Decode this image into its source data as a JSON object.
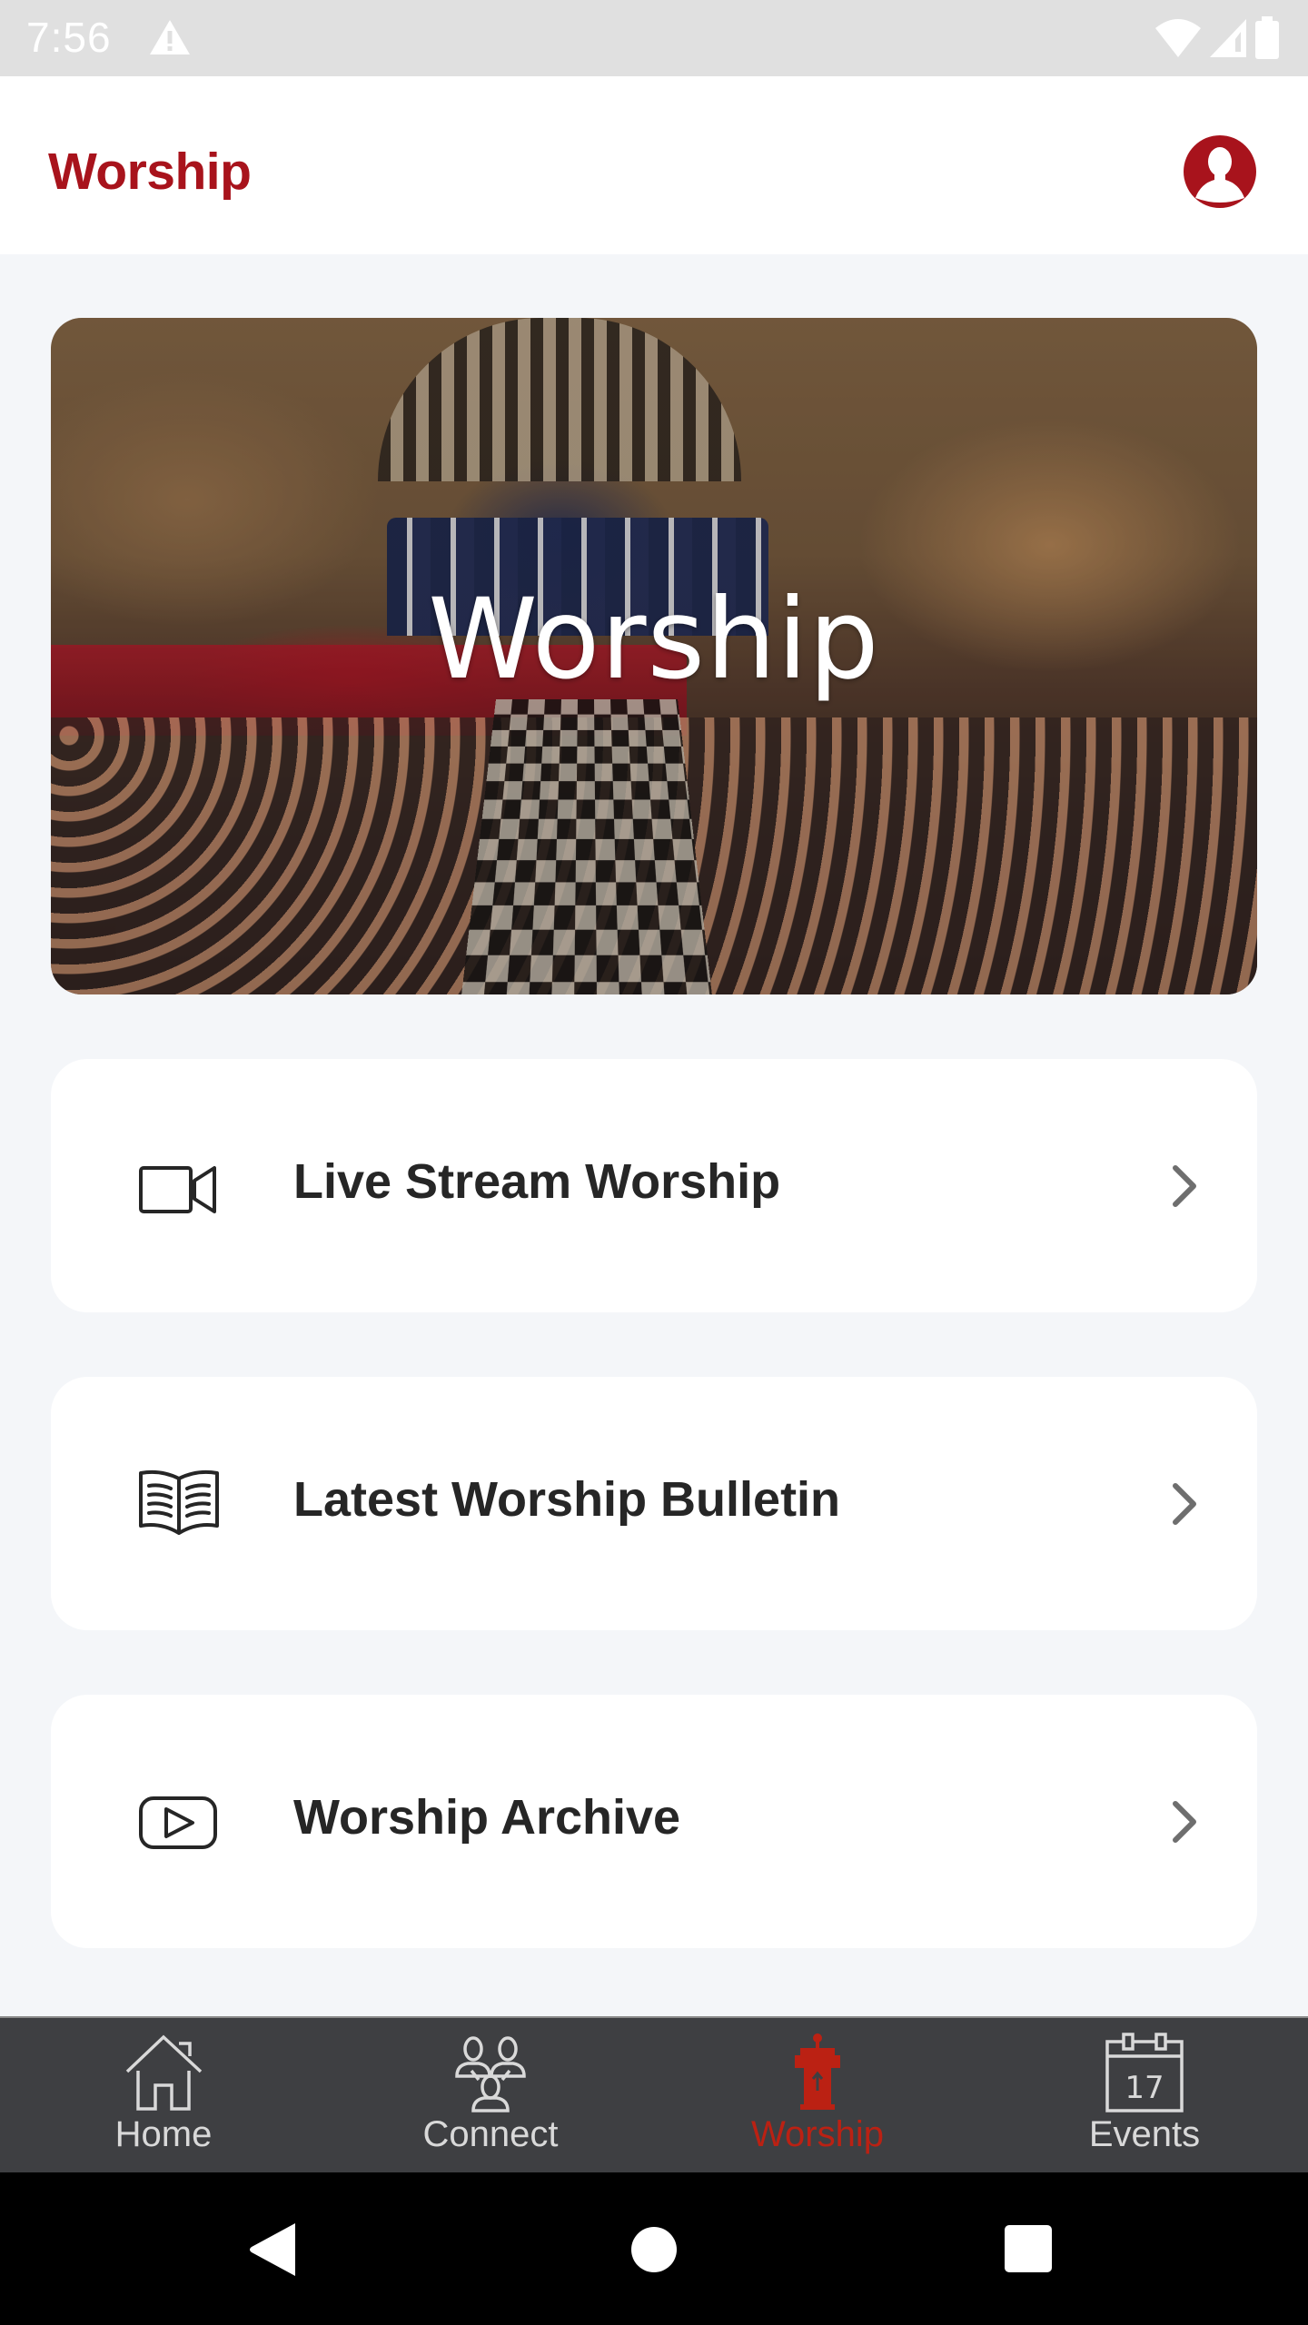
{
  "status_bar": {
    "time": "7:56",
    "icons": [
      "warning-icon",
      "wifi-icon",
      "cell-signal-icon",
      "battery-icon"
    ]
  },
  "header": {
    "title": "Worship",
    "profile_icon": "account-circle-icon"
  },
  "hero": {
    "title": "Worship",
    "image": "church-sanctuary-photo"
  },
  "menu": {
    "items": [
      {
        "label": "Live Stream Worship",
        "icon": "video-camera-icon"
      },
      {
        "label": "Latest Worship Bulletin",
        "icon": "open-book-icon"
      },
      {
        "label": "Worship Archive",
        "icon": "play-video-icon"
      }
    ]
  },
  "bottom_nav": {
    "items": [
      {
        "label": "Home",
        "icon": "home-icon",
        "active": false
      },
      {
        "label": "Connect",
        "icon": "people-connect-icon",
        "active": false
      },
      {
        "label": "Worship",
        "icon": "pulpit-icon",
        "active": true
      },
      {
        "label": "Events",
        "icon": "calendar-icon",
        "active": false,
        "calendar_day": "17"
      }
    ]
  },
  "colors": {
    "brand": "#a8131c",
    "active_tab": "#bb2113",
    "nav_background": "#3e3f42",
    "page_background": "#f4f6f9"
  },
  "system_nav": {
    "buttons": [
      "back",
      "home",
      "recents"
    ]
  }
}
